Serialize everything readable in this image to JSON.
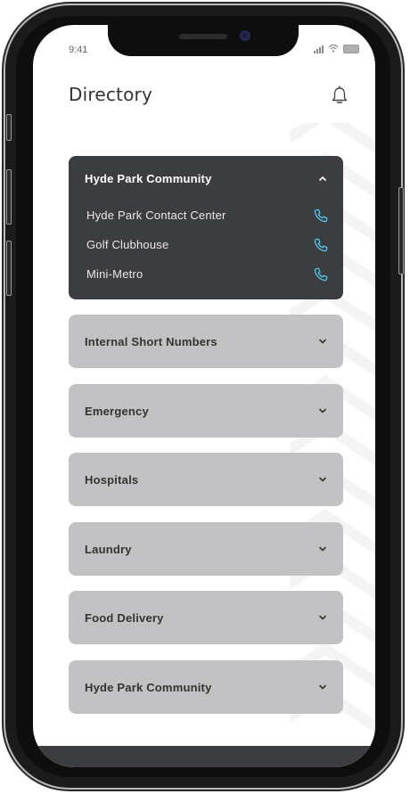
{
  "status_bar": {
    "time": "9:41"
  },
  "header": {
    "title": "Directory",
    "notification_icon": "bell-icon"
  },
  "expanded_section": {
    "title": "Hyde Park Community",
    "contacts": [
      {
        "name": "Hyde Park Contact Center",
        "icon": "phone-icon"
      },
      {
        "name": "Golf Clubhouse",
        "icon": "phone-icon"
      },
      {
        "name": "Mini-Metro",
        "icon": "phone-icon"
      }
    ]
  },
  "sections": [
    {
      "title": "Internal Short Numbers"
    },
    {
      "title": "Emergency"
    },
    {
      "title": "Hospitals"
    },
    {
      "title": "Laundry"
    },
    {
      "title": "Food Delivery"
    },
    {
      "title": "Hyde Park Community"
    }
  ],
  "colors": {
    "accent": "#4fc3e3",
    "card_dark": "#3c3d40",
    "card_light": "#c2c2c4"
  }
}
